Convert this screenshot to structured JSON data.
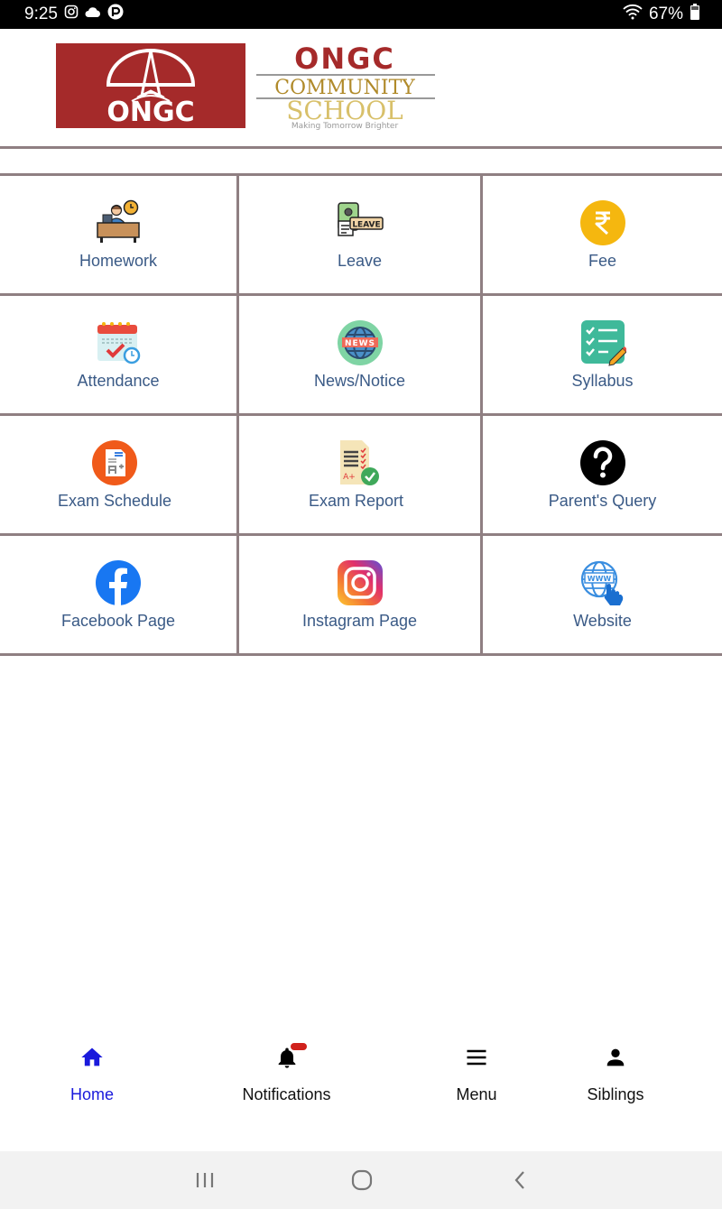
{
  "status_bar": {
    "time": "9:25",
    "left_icons": [
      "instagram-icon",
      "cloud-icon",
      "app-notification-icon"
    ],
    "battery_percent": "67%",
    "right_icons": [
      "wifi-icon",
      "battery-icon"
    ]
  },
  "header": {
    "logo": {
      "left_text": "ONGC",
      "title_line1": "ONGC",
      "title_line2": "COMMUNITY",
      "title_line3": "SCHOOL",
      "tagline": "Making Tomorrow Brighter",
      "brand_color": "#a52a2a",
      "gold_color": "#c9a227"
    }
  },
  "grid": {
    "items": [
      {
        "label": "Homework",
        "icon": "homework-desk-icon"
      },
      {
        "label": "Leave",
        "icon": "leave-icon"
      },
      {
        "label": "Fee",
        "icon": "rupee-icon"
      },
      {
        "label": "Attendance",
        "icon": "calendar-check-icon"
      },
      {
        "label": "News/Notice",
        "icon": "news-globe-icon"
      },
      {
        "label": "Syllabus",
        "icon": "checklist-icon"
      },
      {
        "label": "Exam Schedule",
        "icon": "exam-schedule-icon"
      },
      {
        "label": "Exam Report",
        "icon": "exam-report-icon"
      },
      {
        "label": "Parent's Query",
        "icon": "question-icon"
      },
      {
        "label": "Facebook Page",
        "icon": "facebook-icon"
      },
      {
        "label": "Instagram Page",
        "icon": "instagram-icon"
      },
      {
        "label": "Website",
        "icon": "www-globe-icon"
      }
    ]
  },
  "bottom_nav": {
    "items": [
      {
        "label": "Home",
        "icon": "home-icon",
        "active": true
      },
      {
        "label": "Notifications",
        "icon": "bell-icon",
        "active": false,
        "badge": true
      },
      {
        "label": "Menu",
        "icon": "menu-icon",
        "active": false
      },
      {
        "label": "Siblings",
        "icon": "person-icon",
        "active": false
      }
    ],
    "active_color": "#1a1adc"
  },
  "system_nav": {
    "buttons": [
      "recents-button",
      "home-button",
      "back-button"
    ]
  }
}
